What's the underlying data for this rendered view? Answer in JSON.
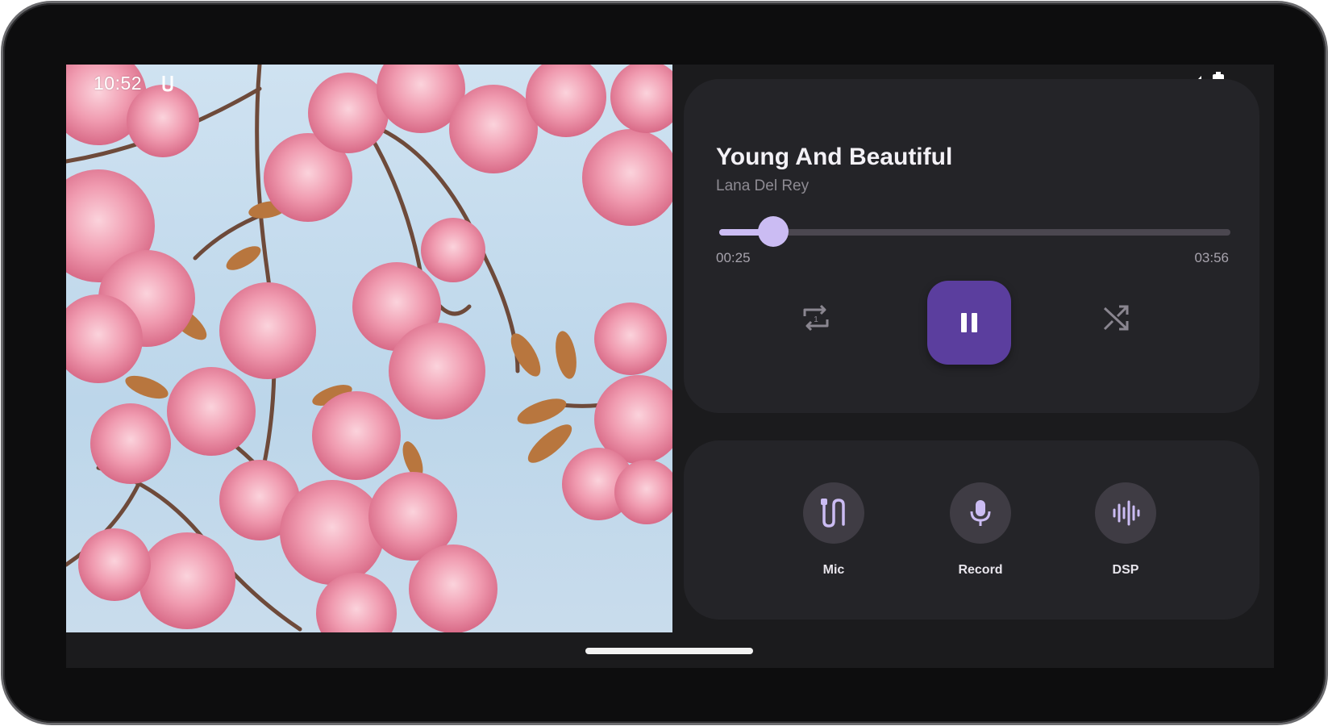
{
  "status_bar": {
    "time": "10:52",
    "notification_icon": "audio-notification-icon",
    "signal_icon": "cell-signal-icon",
    "battery_icon": "battery-full-icon"
  },
  "player": {
    "title": "Young And Beautiful",
    "artist": "Lana Del Rey",
    "elapsed": "00:25",
    "duration": "03:56",
    "progress": 0.106,
    "repeat_icon": "repeat-one-icon",
    "pause_icon": "pause-icon",
    "shuffle_icon": "shuffle-icon"
  },
  "controls": [
    {
      "label": "Mic",
      "icon": "mic-cable-icon"
    },
    {
      "label": "Record",
      "icon": "microphone-icon"
    },
    {
      "label": "DSP",
      "icon": "waveform-icon"
    }
  ],
  "colors": {
    "accent": "#cbbcf3",
    "pause_button": "#5b3e9e",
    "card_background": "#242428",
    "screen_background": "#1b1b1d"
  }
}
